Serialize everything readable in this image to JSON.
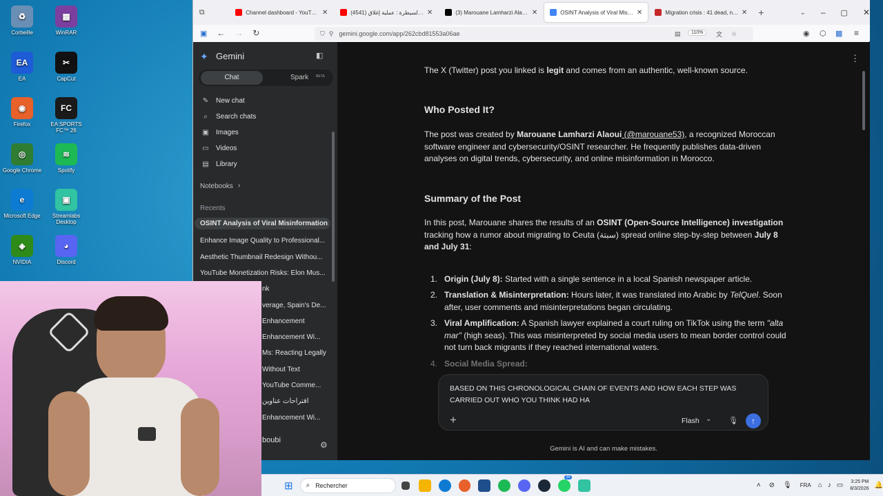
{
  "desktop": {
    "icons": [
      {
        "label": "Corbeille",
        "color": "#6a8fb5",
        "glyph": "♻"
      },
      {
        "label": "WinRAR",
        "color": "#7b3fa0",
        "glyph": "▦"
      },
      {
        "label": "EA",
        "color": "#1e5bd6",
        "glyph": "EA"
      },
      {
        "label": "CapCut",
        "color": "#111111",
        "glyph": "✂"
      },
      {
        "label": "Firefox",
        "color": "#e8602a",
        "glyph": "◉"
      },
      {
        "label": "EA SPORTS FC™ 26",
        "color": "#1a1a1a",
        "glyph": "FC"
      },
      {
        "label": "Google Chrome",
        "color": "#2e7d32",
        "glyph": "◎"
      },
      {
        "label": "Spotify",
        "color": "#1db954",
        "glyph": "≋"
      },
      {
        "label": "Microsoft Edge",
        "color": "#0e7bd3",
        "glyph": "e"
      },
      {
        "label": "Streamlabs Desktop",
        "color": "#31c3a2",
        "glyph": "▣"
      },
      {
        "label": "NVIDIA",
        "color": "#2e8b1a",
        "glyph": "◈"
      },
      {
        "label": "Discord",
        "color": "#5865f2",
        "glyph": "◕"
      }
    ]
  },
  "browser": {
    "tabs": [
      {
        "title": "Channel dashboard - YouTube S",
        "color": "#ff0000"
      },
      {
        "title": "(4541) خارج السيطرة : عملية إغلاق",
        "color": "#ff0000"
      },
      {
        "title": "(3) Marouane Lamharzi Alaoui o",
        "color": "#000000"
      },
      {
        "title": "OSINT Analysis of Viral Misinfor",
        "color": "#4285f4",
        "active": true
      },
      {
        "title": "Migration crisis : 41 dead, near",
        "color": "#c62828"
      }
    ],
    "url": "gemini.google.com/app/262cbd81553a06ae",
    "zoom": "110%"
  },
  "sidebar": {
    "title": "Gemini",
    "tab_chat": "Chat",
    "tab_spark": "Spark",
    "spark_badge": "BETA",
    "nav": [
      {
        "label": "New chat",
        "icon": "✎"
      },
      {
        "label": "Search chats",
        "icon": "⌕"
      },
      {
        "label": "Images",
        "icon": "▣"
      },
      {
        "label": "Videos",
        "icon": "▭"
      },
      {
        "label": "Library",
        "icon": "▤"
      }
    ],
    "notebooks": "Notebooks",
    "recents_label": "Recents",
    "recents": [
      "OSINT Analysis of Viral Misinformation",
      "Enhance Image Quality to Professional...",
      "Aesthetic Thumbnail Redesign Withou...",
      "YouTube Monetization Risks: Elon Mus...",
      "nk",
      "verage, Spain's De...",
      "Enhancement",
      "Enhancement Wi...",
      "Ms: Reacting Legally",
      "Without Text",
      "YouTube Comme...",
      "اقتراحات عناوين",
      "Enhancement Wi..."
    ],
    "user": "boubi"
  },
  "chat": {
    "intro_pre": "The X (Twitter) post you linked is ",
    "intro_bold": "legit",
    "intro_post": " and comes from an authentic, well-known source.",
    "h1": "Who Posted It?",
    "p1_pre": "The post was created by ",
    "p1_bold": "Marouane Lamharzi Alaoui",
    "p1_handle": " (@marouane53)",
    "p1_post": ", a recognized Moroccan software engineer and cybersecurity/OSINT researcher. He frequently publishes data-driven analyses on digital trends, cybersecurity, and online misinformation in Morocco.",
    "h2": "Summary of the Post",
    "p2_pre": "In this post, Marouane shares the results of an ",
    "p2_bold": "OSINT (Open-Source Intelligence) investigation",
    "p2_mid": " tracking how a rumor about migrating to Ceuta (سبتة) spread online step-by-step between ",
    "p2_bold2": "July 8 and July 31",
    "p2_end": ":",
    "list": [
      {
        "num": "1.",
        "bold": "Origin (July 8):",
        "text": " Started with a single sentence in a local Spanish newspaper article."
      },
      {
        "num": "2.",
        "bold": "Translation & Misinterpretation:",
        "text": " Hours later, it was translated into Arabic by ",
        "italic": "TelQuel",
        "text2": ". Soon after, user comments and misinterpretations began circulating."
      },
      {
        "num": "3.",
        "bold": "Viral Amplification:",
        "text": " A Spanish lawyer explained a court ruling on TikTok using the term ",
        "italic": "\"alta mar\"",
        "text2": " (high seas). This was misinterpreted by social media users to mean border control could not turn back migrants if they reached international waters."
      },
      {
        "num": "4.",
        "bold": "Social Media Spread:",
        "text": ""
      }
    ],
    "input_text": "BASED ON THIS CHRONOLOGICAL CHAIN OF EVENTS AND HOW EACH STEP WAS CARRIED OUT WHO YOU THINK HAD HA",
    "model": "Flash",
    "disclaimer": "Gemini is AI and can make mistakes."
  },
  "taskbar": {
    "search": "Rechercher",
    "lang": "FRA",
    "time": "3:25 PM",
    "date": "8/3/2026",
    "badge": "38"
  }
}
